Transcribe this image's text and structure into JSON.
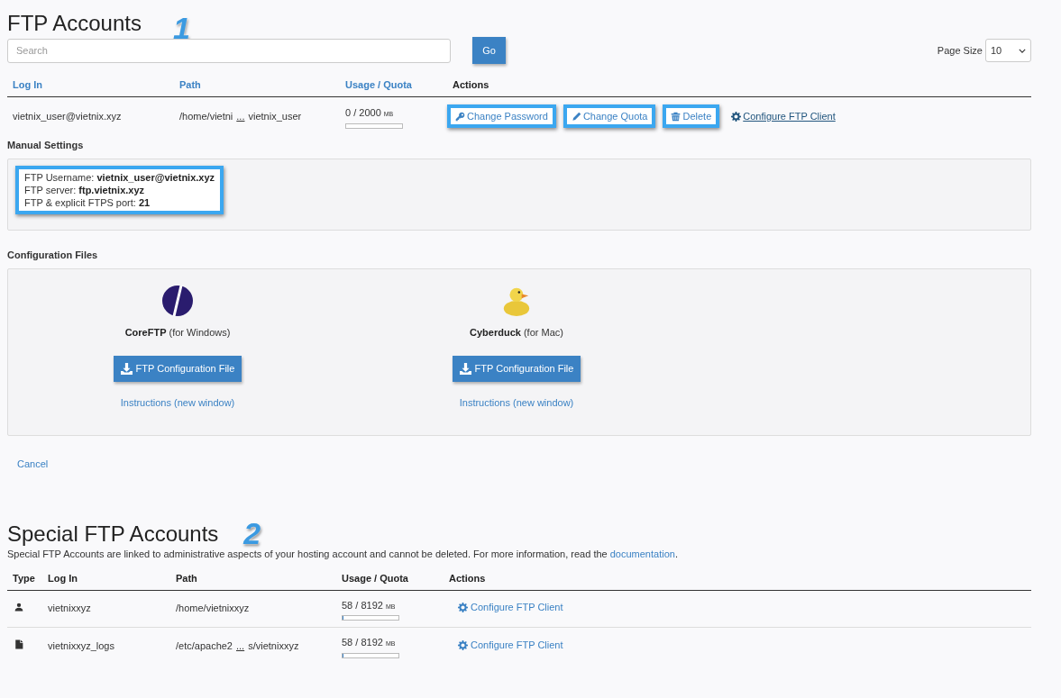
{
  "accounts": {
    "title": "FTP Accounts",
    "marker": "1",
    "search": {
      "placeholder": "Search",
      "button": "Go"
    },
    "page_size": {
      "label": "Page Size",
      "value": "10"
    },
    "columns": [
      {
        "label": "Log In",
        "kind": "link"
      },
      {
        "label": "Path",
        "kind": "link"
      },
      {
        "label": "Usage / Quota",
        "kind": "usage"
      },
      {
        "label": "Actions",
        "kind": "plain"
      }
    ],
    "rows": [
      {
        "login": "vietnix_user@vietnix.xyz",
        "path_start": "/home/vietni",
        "path_ellipsis": "...",
        "path_end": "vietnix_user",
        "usage": "0 / 2000",
        "unit": "MB",
        "level": 0,
        "actions": [
          {
            "label": "Change Password",
            "kind": "key",
            "highlighted": true,
            "underlined": false
          },
          {
            "label": "Change Quota",
            "kind": "pencil",
            "highlighted": true,
            "underlined": false
          },
          {
            "label": "Delete",
            "kind": "trash",
            "highlighted": true,
            "underlined": false
          },
          {
            "label": "Configure FTP Client",
            "kind": "gear",
            "highlighted": false,
            "underlined": true
          }
        ]
      }
    ]
  },
  "manual_settings": {
    "title": "Manual Settings",
    "highlighted": true,
    "lines": [
      {
        "label": "FTP Username:",
        "value": "vietnix_user@vietnix.xyz"
      },
      {
        "label": "FTP server:",
        "value": "ftp.vietnix.xyz"
      },
      {
        "label": "FTP & explicit FTPS port:",
        "value": "21"
      }
    ]
  },
  "configuration_files": {
    "title": "Configuration Files",
    "clients": [
      {
        "kind": "coreftp",
        "name": "CoreFTP",
        "platform": "(for Windows)",
        "button": "FTP Configuration File",
        "link": "Instructions (new window)"
      },
      {
        "kind": "cyberduck",
        "name": "Cyberduck",
        "platform": "(for Mac)",
        "button": "FTP Configuration File",
        "link": "Instructions (new window)"
      }
    ]
  },
  "cancel": "Cancel",
  "special": {
    "title": "Special FTP Accounts",
    "marker": "2",
    "description_text": "Special FTP Accounts are linked to administrative aspects of your hosting account and cannot be deleted. For more information, read the ",
    "description_link": "documentation",
    "description_end": ".",
    "columns": [
      "Type",
      "Log In",
      "Path",
      "Usage / Quota",
      "Actions"
    ],
    "rows": [
      {
        "kind": "user",
        "login": "vietnixxyz",
        "path_start": "/home/vietnixxyz",
        "usage": "58 / 8192",
        "unit": "MB",
        "level": 0.01,
        "action": "Configure FTP Client"
      },
      {
        "kind": "file",
        "login": "vietnixxyz_logs",
        "path_start": "/etc/apache2",
        "path_ellipsis": "...",
        "path_end": "s/vietnixxyz",
        "usage": "58 / 8192",
        "unit": "MB",
        "level": 0.01,
        "action": "Configure FTP Client"
      }
    ]
  }
}
